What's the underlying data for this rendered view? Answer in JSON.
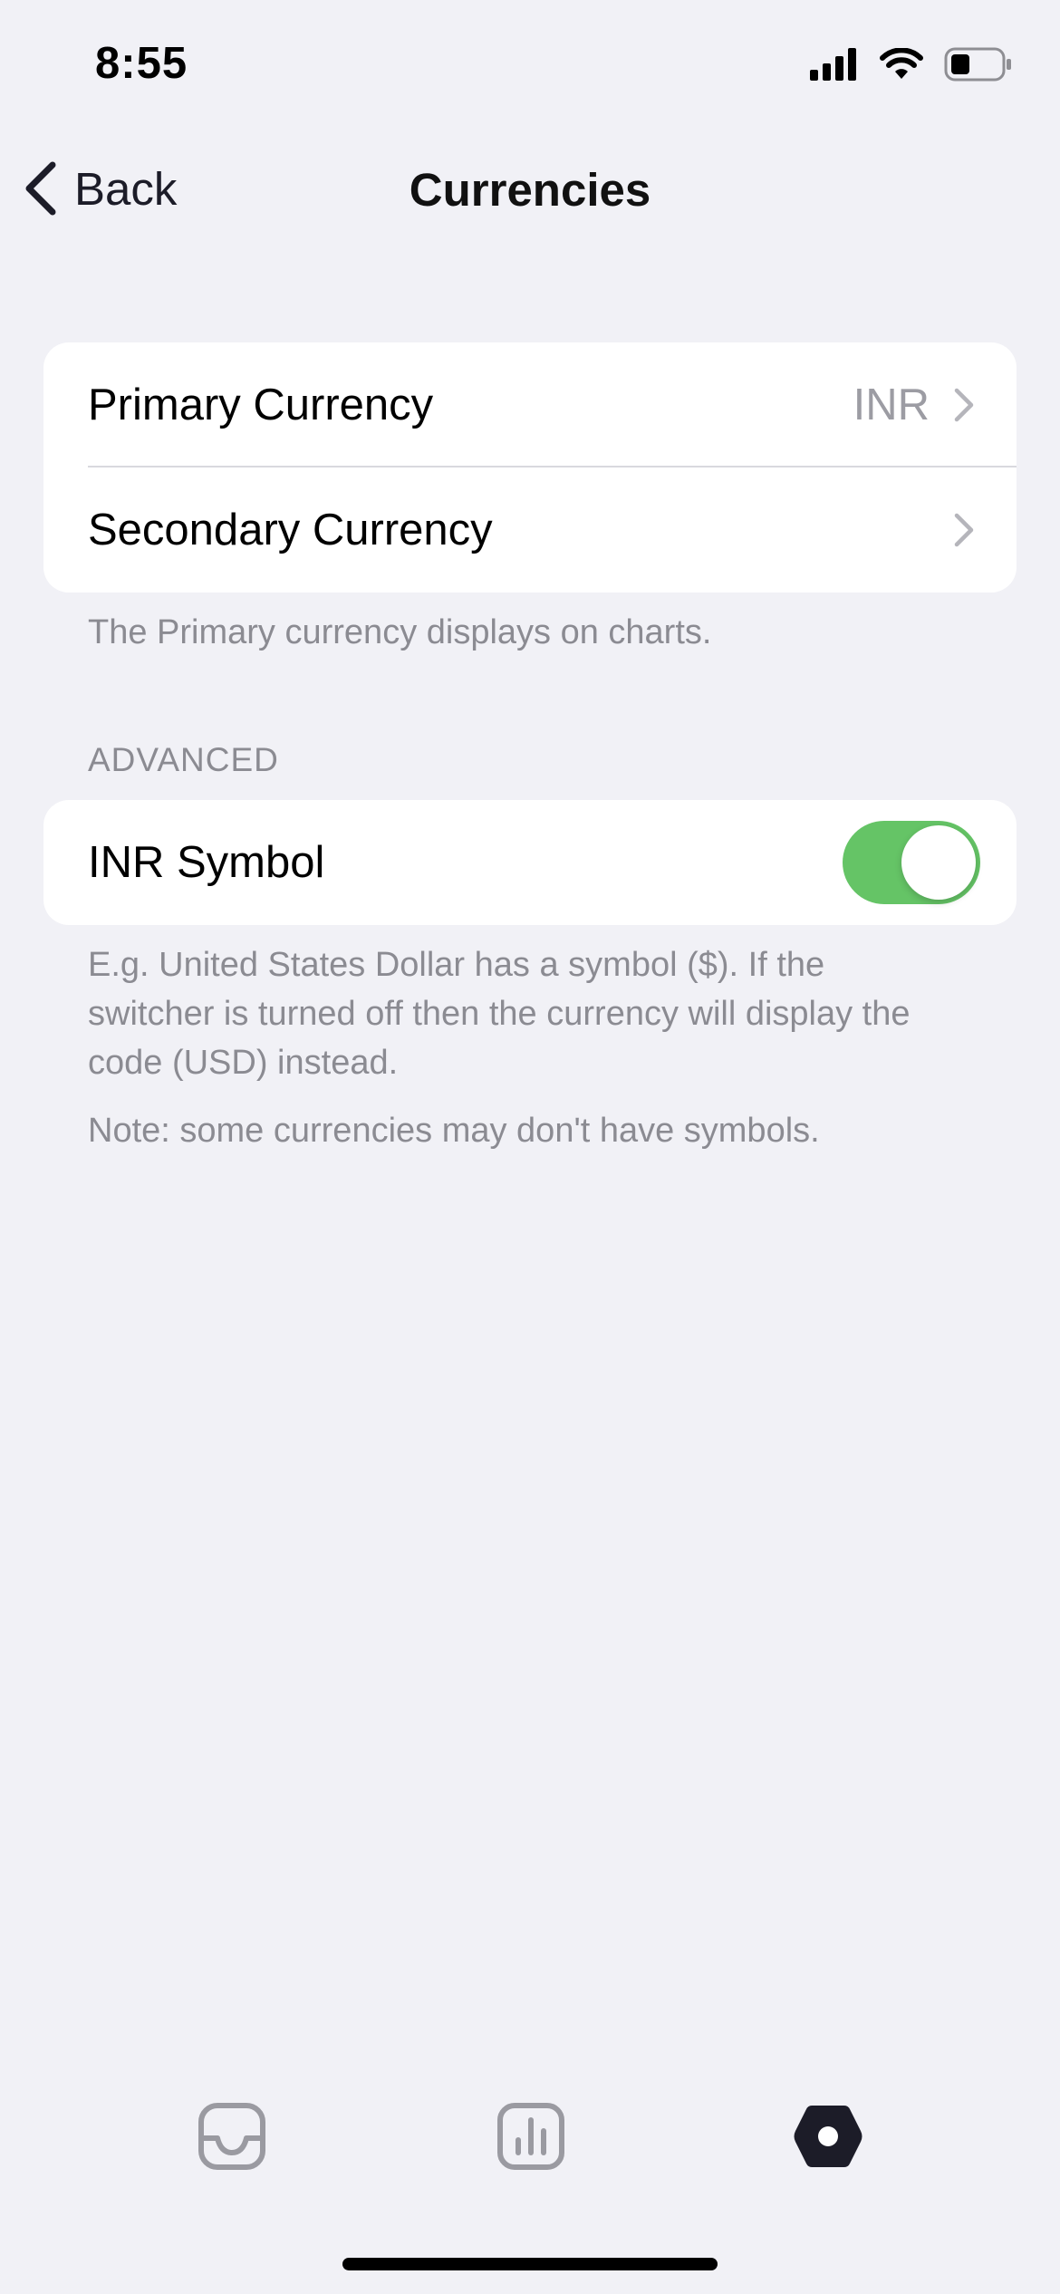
{
  "status_bar": {
    "time": "8:55"
  },
  "nav": {
    "back_label": "Back",
    "title": "Currencies"
  },
  "currency_group": {
    "primary": {
      "label": "Primary Currency",
      "value": "INR"
    },
    "secondary": {
      "label": "Secondary Currency",
      "value": ""
    },
    "footnote": "The Primary currency displays on charts."
  },
  "advanced": {
    "header": "ADVANCED",
    "symbol_toggle": {
      "label": "INR Symbol",
      "on": true
    },
    "footnote": "E.g. United States Dollar has a symbol ($). If the switcher is turned off then the currency will display the code (USD) instead.",
    "note": "Note: some currencies may don't have symbols."
  },
  "tab_bar": {
    "tabs": [
      {
        "icon": "inbox-icon",
        "active": false
      },
      {
        "icon": "chart-icon",
        "active": false
      },
      {
        "icon": "settings-icon",
        "active": true
      }
    ]
  },
  "colors": {
    "background": "#f1f1f6",
    "toggle_on": "#65c466",
    "secondary_text": "#8b8b92",
    "inactive_icon": "#9a9aa1",
    "active_icon": "#1c1c28"
  }
}
